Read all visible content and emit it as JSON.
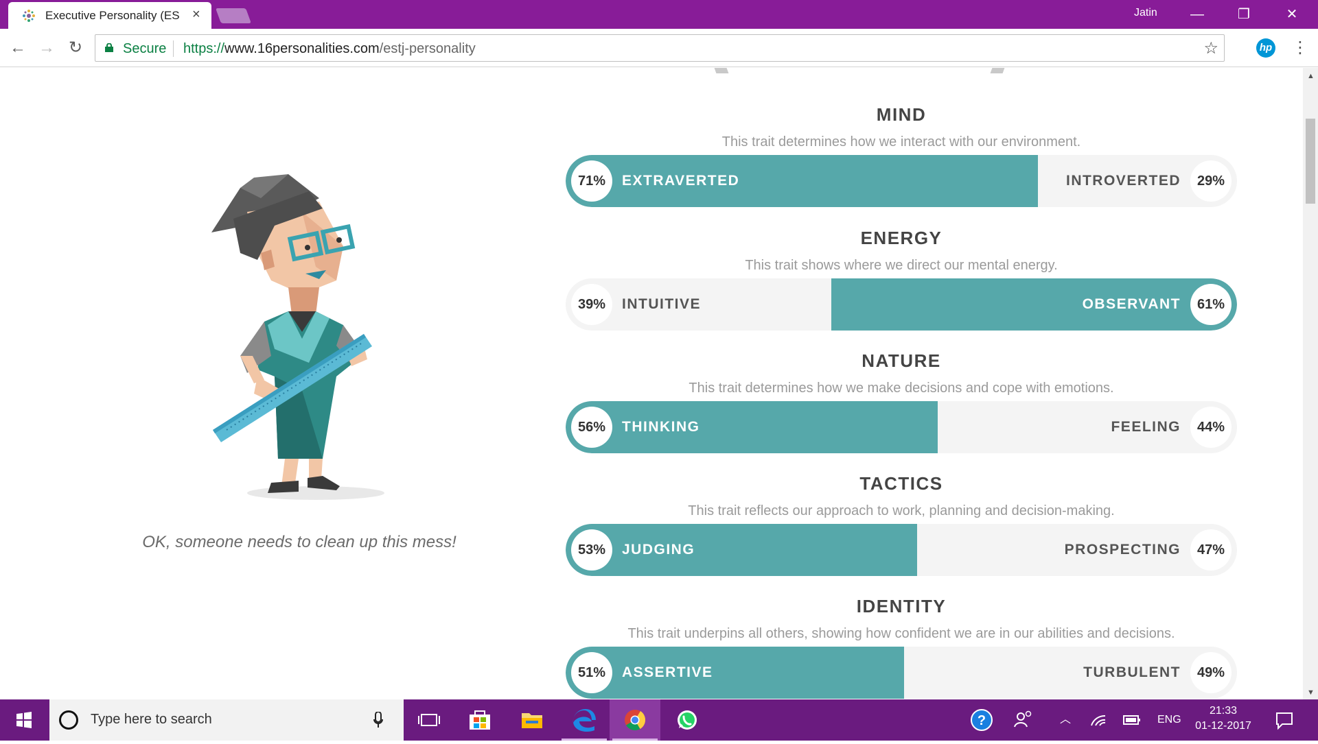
{
  "browser": {
    "tab": {
      "title": "Executive Personality (ES",
      "close": "×"
    },
    "user": "Jatin",
    "window_controls": {
      "minimize": "—",
      "restore": "❐",
      "close": "✕"
    },
    "nav": {
      "back": "←",
      "forward": "→",
      "reload": "↻"
    },
    "address": {
      "secure_label": "Secure",
      "scheme": "https://",
      "host": "www.16personalities.com",
      "path": "/estj-personality"
    },
    "star": "☆",
    "extension": "hp",
    "menu": "⋮"
  },
  "page": {
    "quote": "OK, someone needs to clean up this mess!",
    "traits": [
      {
        "title": "MIND",
        "description": "This trait determines how we interact with our environment.",
        "left": {
          "label": "EXTRAVERTED",
          "percent": "71%"
        },
        "right": {
          "label": "INTROVERTED",
          "percent": "29%"
        },
        "dominant": "left",
        "value": 71
      },
      {
        "title": "ENERGY",
        "description": "This trait shows where we direct our mental energy.",
        "left": {
          "label": "INTUITIVE",
          "percent": "39%"
        },
        "right": {
          "label": "OBSERVANT",
          "percent": "61%"
        },
        "dominant": "right",
        "value": 61
      },
      {
        "title": "NATURE",
        "description": "This trait determines how we make decisions and cope with emotions.",
        "left": {
          "label": "THINKING",
          "percent": "56%"
        },
        "right": {
          "label": "FEELING",
          "percent": "44%"
        },
        "dominant": "left",
        "value": 56
      },
      {
        "title": "TACTICS",
        "description": "This trait reflects our approach to work, planning and decision-making.",
        "left": {
          "label": "JUDGING",
          "percent": "53%"
        },
        "right": {
          "label": "PROSPECTING",
          "percent": "47%"
        },
        "dominant": "left",
        "value": 53
      },
      {
        "title": "IDENTITY",
        "description": "This trait underpins all others, showing how confident we are in our abilities and decisions.",
        "left": {
          "label": "ASSERTIVE",
          "percent": "51%"
        },
        "right": {
          "label": "TURBULENT",
          "percent": "49%"
        },
        "dominant": "left",
        "value": 51
      }
    ],
    "accent_color": "#56a8aa"
  },
  "taskbar": {
    "search_placeholder": "Type here to search",
    "apps": [
      "task-view-icon",
      "store-icon",
      "file-explorer-icon",
      "edge-icon",
      "chrome-icon",
      "whatsapp-icon"
    ],
    "tray": {
      "language": "ENG",
      "time": "21:33",
      "date": "01-12-2017"
    }
  }
}
